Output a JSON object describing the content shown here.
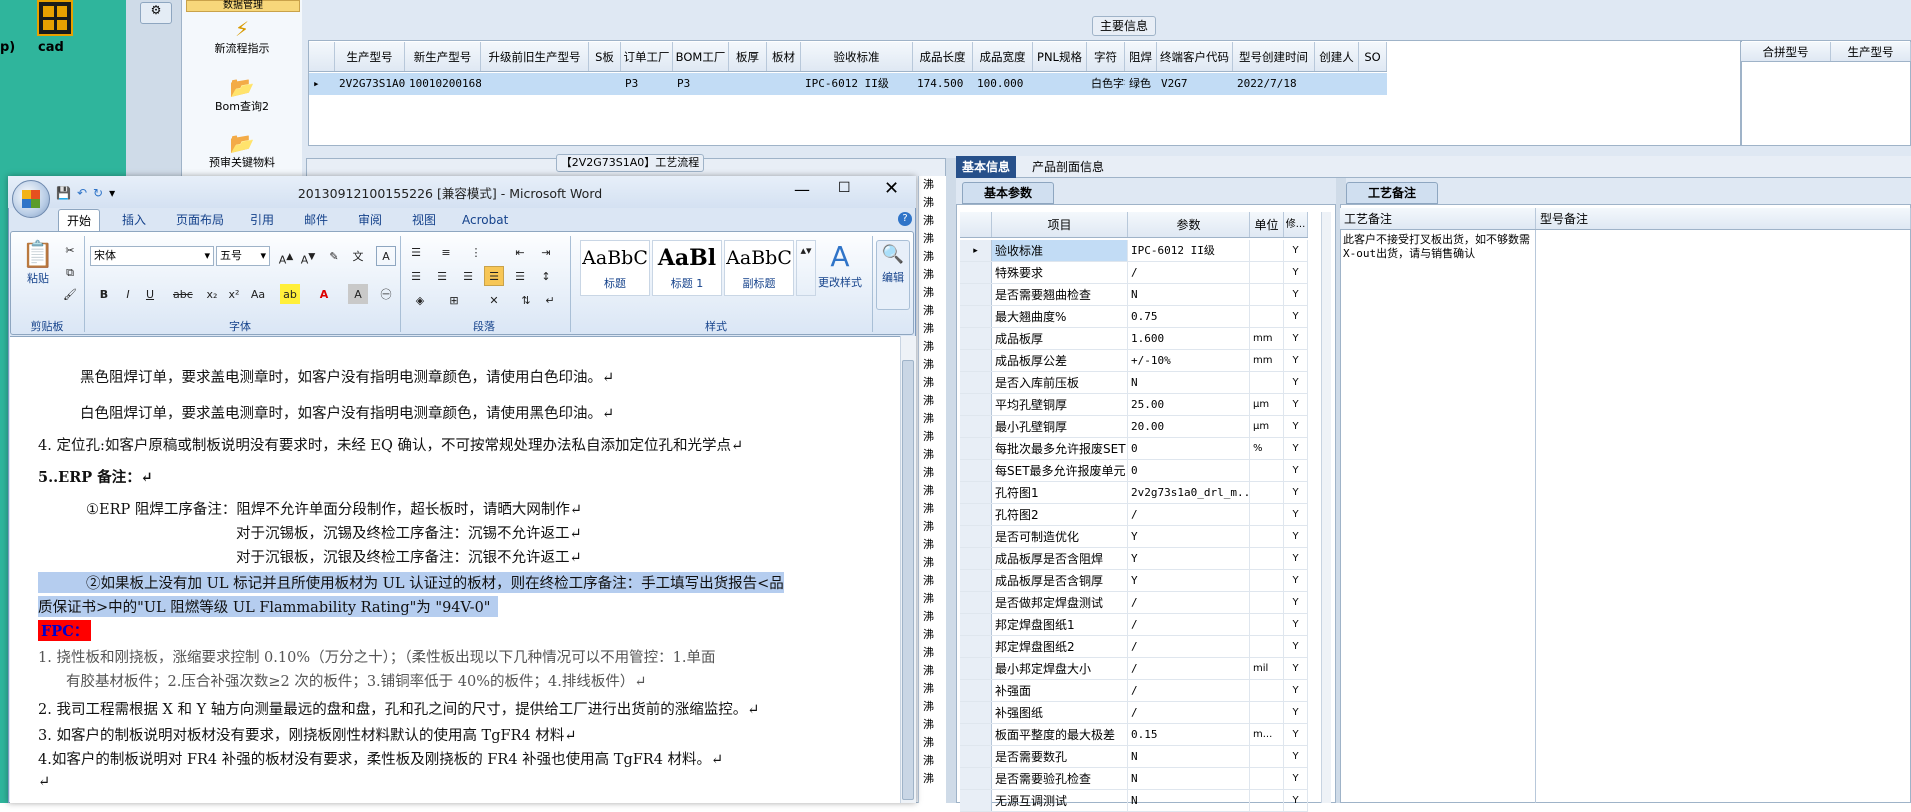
{
  "desktop": {
    "cad_label": "cad",
    "p_label": "p)"
  },
  "nav": {
    "top_label": "数据管理",
    "items": [
      {
        "label": "新流程指示",
        "icon": "lightning-icon"
      },
      {
        "label": "Bom查询2",
        "icon": "folder-icon"
      },
      {
        "label": "预审关键物料",
        "icon": "folder-icon"
      }
    ]
  },
  "main_info": {
    "title": "主要信息",
    "columns": [
      "生产型号",
      "新生产型号",
      "升级前旧生产型号",
      "S板",
      "订单工厂",
      "BOM工厂",
      "板厚",
      "板材",
      "验收标准",
      "成品长度",
      "成品宽度",
      "PNL规格",
      "字符",
      "阻焊",
      "终端客户代码",
      "型号创建时间",
      "创建人",
      "SO"
    ],
    "row": [
      "2V2G73S1A0",
      "10010200168252",
      "",
      "",
      "P3",
      "P3",
      "",
      "",
      "IPC-6012 II级",
      "174.500",
      "100.000",
      "",
      "白色字符",
      "绿色",
      "V2G7",
      "2022/7/18",
      "",
      ""
    ],
    "right_columns": [
      "合拼型号",
      "生产型号"
    ]
  },
  "process": {
    "title": "【2V2G73S1A0】工艺流程",
    "strip": [
      "沸",
      "沸",
      "沸",
      "沸",
      "沸",
      "沸",
      "沸",
      "沸",
      "沸",
      "沸",
      "沸",
      "沸",
      "沸",
      "沸",
      "沸",
      "沸",
      "沸",
      "沸",
      "沸",
      "沸",
      "沸",
      "沸",
      "沸",
      "沸",
      "沸",
      "沸",
      "沸",
      "沸",
      "沸",
      "沸",
      "沸",
      "沸",
      "沸",
      "沸"
    ]
  },
  "tabs": {
    "basic": "基本信息",
    "profile": "产品剖面信息"
  },
  "params": {
    "subtab": "基本参数",
    "headers": [
      "项目",
      "参数",
      "单位",
      "修..."
    ],
    "rows": [
      {
        "item": "验收标准",
        "value": "IPC-6012 II级",
        "unit": "",
        "mod": "Y"
      },
      {
        "item": "特殊要求",
        "value": "/",
        "unit": "",
        "mod": "Y"
      },
      {
        "item": "是否需要翘曲检查",
        "value": "N",
        "unit": "",
        "mod": "Y"
      },
      {
        "item": "最大翘曲度%",
        "value": "0.75",
        "unit": "",
        "mod": "Y"
      },
      {
        "item": "成品板厚",
        "value": "1.600",
        "unit": "mm",
        "mod": "Y"
      },
      {
        "item": "成品板厚公差",
        "value": "+/-10%",
        "unit": "mm",
        "mod": "Y"
      },
      {
        "item": "是否入库前压板",
        "value": "N",
        "unit": "",
        "mod": "Y"
      },
      {
        "item": "平均孔壁铜厚",
        "value": "25.00",
        "unit": "μm",
        "mod": "Y"
      },
      {
        "item": "最小孔壁铜厚",
        "value": "20.00",
        "unit": "μm",
        "mod": "Y"
      },
      {
        "item": "每批次最多允许报废SET",
        "value": "0",
        "unit": "%",
        "mod": "Y"
      },
      {
        "item": "每SET最多允许报废单元",
        "value": "0",
        "unit": "",
        "mod": "Y"
      },
      {
        "item": "孔符图1",
        "value": "2v2g73s1a0_drl_m...",
        "unit": "",
        "mod": "Y"
      },
      {
        "item": "孔符图2",
        "value": "/",
        "unit": "",
        "mod": "Y"
      },
      {
        "item": "是否可制造优化",
        "value": "Y",
        "unit": "",
        "mod": "Y"
      },
      {
        "item": "成品板厚是否含阻焊",
        "value": "Y",
        "unit": "",
        "mod": "Y"
      },
      {
        "item": "成品板厚是否含铜厚",
        "value": "Y",
        "unit": "",
        "mod": "Y"
      },
      {
        "item": "是否做邦定焊盘测试",
        "value": "/",
        "unit": "",
        "mod": "Y"
      },
      {
        "item": "邦定焊盘图纸1",
        "value": "/",
        "unit": "",
        "mod": "Y"
      },
      {
        "item": "邦定焊盘图纸2",
        "value": "/",
        "unit": "",
        "mod": "Y"
      },
      {
        "item": "最小邦定焊盘大小",
        "value": "/",
        "unit": "mil",
        "mod": "Y"
      },
      {
        "item": "补强面",
        "value": "/",
        "unit": "",
        "mod": "Y"
      },
      {
        "item": "补强图纸",
        "value": "/",
        "unit": "",
        "mod": "Y"
      },
      {
        "item": "板面平整度的最大极差",
        "value": "0.15",
        "unit": "m...",
        "mod": "Y"
      },
      {
        "item": "是否需要数孔",
        "value": "N",
        "unit": "",
        "mod": "Y"
      },
      {
        "item": "是否需要验孔检查",
        "value": "N",
        "unit": "",
        "mod": "Y"
      },
      {
        "item": "无源互调测试",
        "value": "N",
        "unit": "",
        "mod": "Y"
      }
    ]
  },
  "craft": {
    "subtab": "工艺备注",
    "headers": [
      "工艺备注",
      "型号备注"
    ],
    "note": "此客户不接受打叉板出货，如不够数需X-out出货，请与销售确认"
  },
  "word": {
    "title": "20130912100155226 [兼容模式] - Microsoft Word",
    "tabs": [
      "开始",
      "插入",
      "页面布局",
      "引用",
      "邮件",
      "审阅",
      "视图",
      "Acrobat"
    ],
    "font_name": "宋体",
    "font_size": "五号",
    "group_labels": [
      "剪贴板",
      "字体",
      "段落",
      "样式"
    ],
    "paste_label": "粘贴",
    "styles": [
      {
        "preview": "AaBbC",
        "label": "标题"
      },
      {
        "preview": "AaBl",
        "label": "标题 1"
      },
      {
        "preview": "AaBbC",
        "label": "副标题"
      }
    ],
    "change_styles": "更改样式",
    "edit_label": "编辑",
    "doc_lines": [
      "黑色阻焊订单，要求盖电测章时，如客户没有指明电测章颜色，请使用白色印油。↵",
      "白色阻焊订单，要求盖电测章时，如客户没有指明电测章颜色，请使用黑色印油。↵",
      "4.  定位孔:如客户原稿或制板说明没有要求时，未经 EQ 确认，不可按常规处理办法私自添加定位孔和光学点↵",
      "5..ERP 备注：↵",
      "①ERP 阻焊工序备注：阻焊不允许单面分段制作，超长板时，请晒大网制作↵",
      "对于沉锡板，沉锡及终检工序备注：沉锡不允许返工↵",
      "对于沉银板，沉银及终检工序备注：沉银不允许返工↵",
      "②如果板上没有加 UL 标记并且所使用板材为 UL 认证过的板材，则在终检工序备注：手工填写出货报告<品",
      "质保证书>中的\"UL 阻燃等级 UL Flammability Rating\"为 \"94V-0\"",
      "FPC：",
      "1.   挠性板和刚挠板，涨缩要求控制  0.10%（万分之十）；（柔性板出现以下几种情况可以不用管控：1.单面",
      "有胶基材板件；2.压合补强次数≥2 次的板件；3.铺铜率低于 40%的板件；4.排线板件）↵",
      "2.   我司工程需根据 X 和 Y 轴方向测量最远的盘和盘，孔和孔之间的尺寸，提供给工厂进行出货前的涨缩监控。↵",
      "3. 如客户的制板说明对板材没有要求，刚挠板刚性材料默认的使用高 TgFR4 材料↵",
      " 4.如客户的制板说明对 FR4 补强的板材没有要求，柔性板及刚挠板的 FR4 补强也使用高 TgFR4 材料。↵",
      "↵"
    ]
  }
}
